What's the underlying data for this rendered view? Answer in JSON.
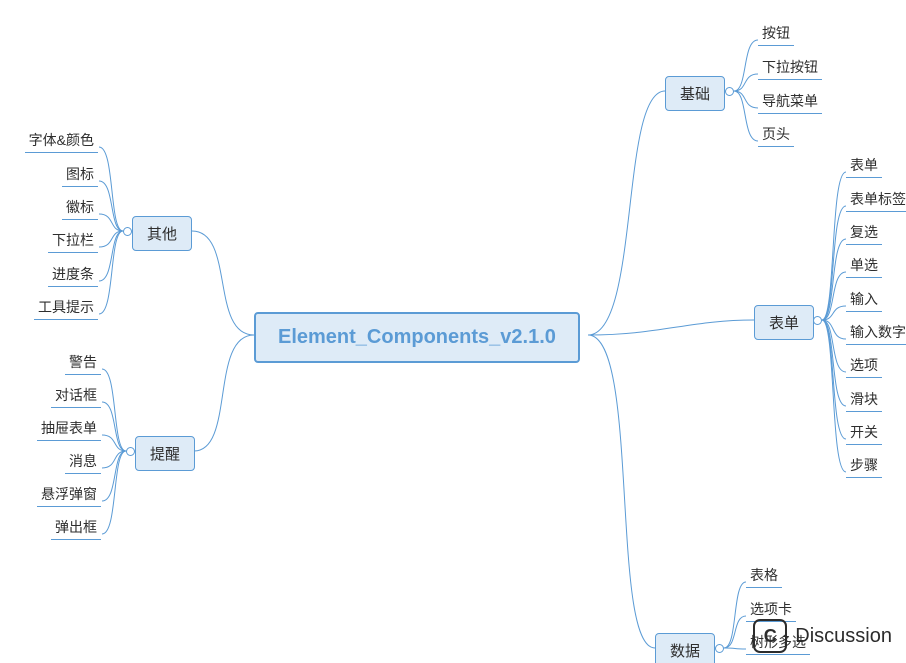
{
  "root": {
    "label": "Element_Components_v2.1.0"
  },
  "branches": {
    "basic": {
      "label": "基础",
      "side": "right",
      "leaves": [
        "按钮",
        "下拉按钮",
        "导航菜单",
        "页头"
      ]
    },
    "form": {
      "label": "表单",
      "side": "right",
      "leaves": [
        "表单",
        "表单标签",
        "复选",
        "单选",
        "输入",
        "输入数字",
        "选项",
        "滑块",
        "开关",
        "步骤"
      ]
    },
    "data": {
      "label": "数据",
      "side": "right",
      "leaves": [
        "表格",
        "选项卡",
        "树形多选"
      ]
    },
    "other": {
      "label": "其他",
      "side": "left",
      "leaves": [
        "字体&颜色",
        "图标",
        "徽标",
        "下拉栏",
        "进度条",
        "工具提示"
      ]
    },
    "alert": {
      "label": "提醒",
      "side": "left",
      "leaves": [
        "警告",
        "对话框",
        "抽屉表单",
        "消息",
        "悬浮弹窗",
        "弹出框"
      ]
    }
  },
  "footer": {
    "badge": "C",
    "label": "Discussion"
  }
}
